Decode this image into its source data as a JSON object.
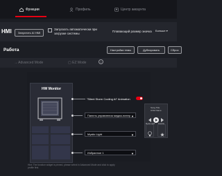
{
  "topbar": {
    "tabs": [
      {
        "label": "Функции",
        "icon": "house-icon",
        "active": true
      },
      {
        "label": "Профиль",
        "icon": "user-icon",
        "active": false
      },
      {
        "label": "Центр аккаунта",
        "icon": "account-icon",
        "active": false
      }
    ],
    "accent_color": "#e60012"
  },
  "hmi": {
    "title": "HMI",
    "launch_button": "Запустить AI HMI",
    "autostart_label": "Запускать автоматически при загрузке системы",
    "scale_label": "Плавающий размер значка",
    "scale_value": "Больше"
  },
  "work": {
    "title": "Работа",
    "buttons": [
      "Настройки темы",
      "Дублировать",
      "Сброс"
    ]
  },
  "modes": {
    "advanced": "Advanced Mode",
    "ez": "EZ Mode",
    "info_icon": "i"
  },
  "widget": {
    "title": "HW Monitor",
    "rows": [
      {
        "label": "\"Silent Storm Cooling AI\" Animation",
        "control": "toggle",
        "value": true
      },
      {
        "label": "Панель управления медиа-плеером",
        "control": "dropdown"
      },
      {
        "label": "Mystic Light",
        "control": "dropdown"
      },
      {
        "label": "Избранное 1",
        "control": "dropdown"
      }
    ]
  },
  "media_widget": {
    "title": "Song Title",
    "artist": "Artist Name",
    "label_left": "Mystic Light",
    "label_right": "Favorite"
  },
  "note": "Hint: The function widget is pinned, please select in Advanced Mode and click to apply profile first."
}
